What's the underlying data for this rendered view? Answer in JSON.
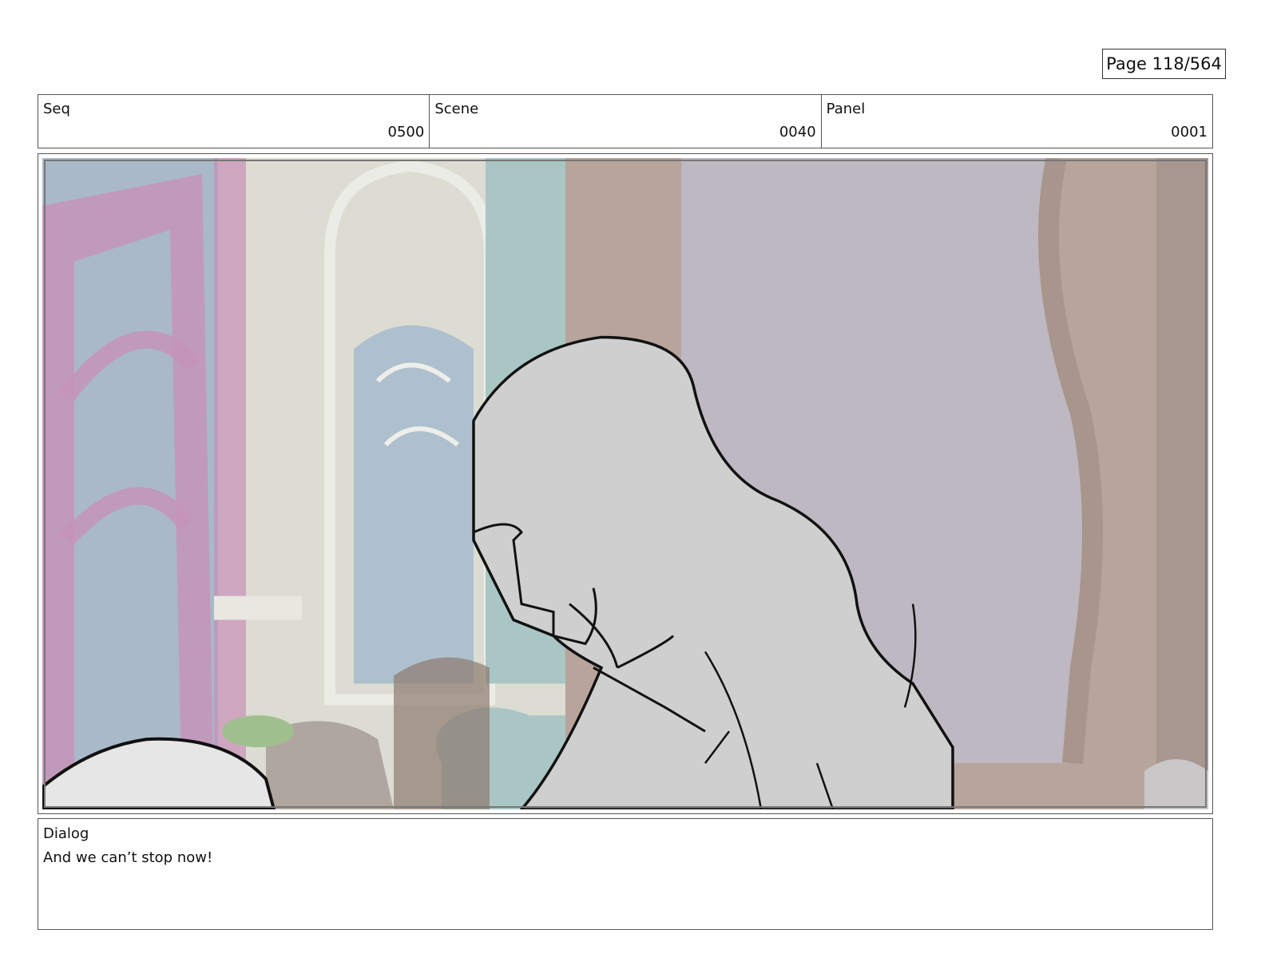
{
  "page": {
    "label": "Page 118/564"
  },
  "header": {
    "seq": {
      "label": "Seq",
      "value": "0500"
    },
    "scene": {
      "label": "Scene",
      "value": "0040"
    },
    "panel": {
      "label": "Panel",
      "value": "0001"
    }
  },
  "dialog": {
    "label": "Dialog",
    "text": "And we can’t stop now!"
  },
  "colors": {
    "border": "#555555",
    "wall_left": "#a9b9c8",
    "window_frame_pink": "#c693b8",
    "wall_cream": "#dcdcd2",
    "column_teal": "#a9c6c5",
    "wall_taupe": "#b7a59c",
    "back_window": "#bdb8c2",
    "character_fill": "#cfcfcf"
  }
}
